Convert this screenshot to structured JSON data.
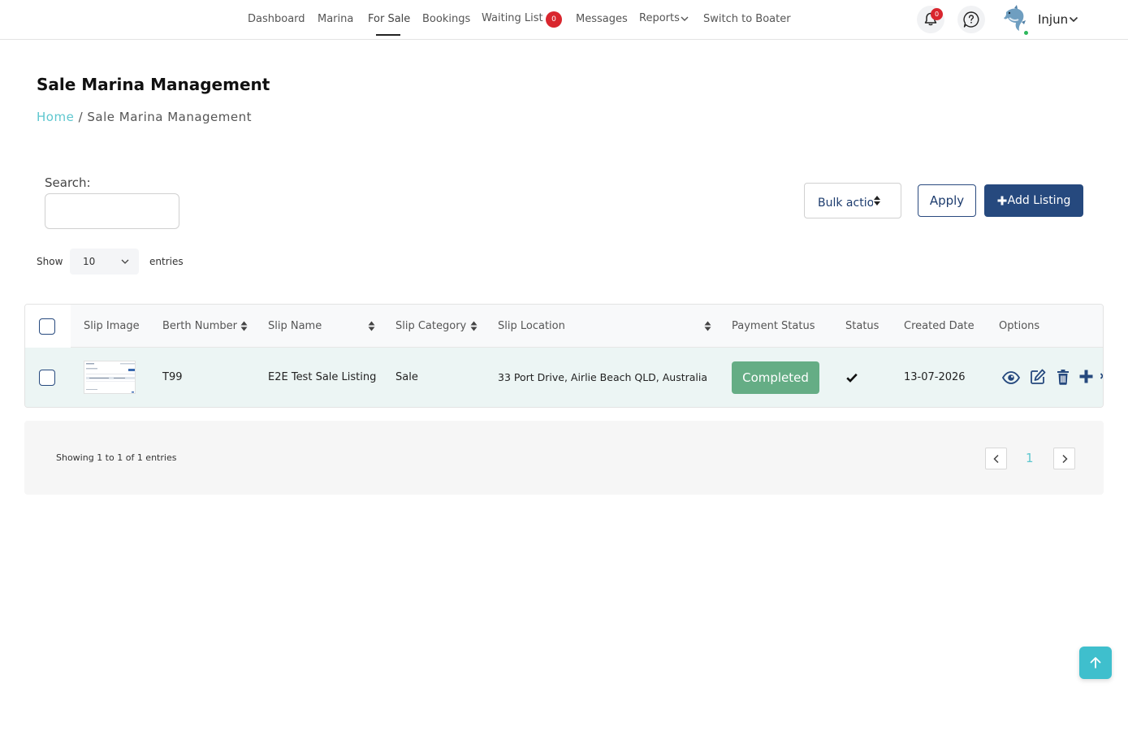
{
  "nav": {
    "items": [
      {
        "label": "Dashboard"
      },
      {
        "label": "Marina"
      },
      {
        "label": "For Sale"
      },
      {
        "label": "Bookings"
      },
      {
        "label": "Waiting List"
      },
      {
        "label": "Messages"
      },
      {
        "label": "Reports"
      },
      {
        "label": "Switch to Boater"
      }
    ],
    "active": "For Sale",
    "waiting_list_count": "0",
    "notifications_count": "0",
    "user_name": "Injun"
  },
  "page": {
    "title": "Sale Marina Management",
    "breadcrumb": {
      "home": "Home",
      "separator": " / ",
      "current": "Sale Marina Management"
    }
  },
  "controls": {
    "search_label": "Search:",
    "search_value": "",
    "bulk_action": "Bulk actions",
    "apply_label": "Apply",
    "add_label": "Add Listing",
    "show_label": "Show",
    "entries_value": "10",
    "entries_label": "entries"
  },
  "table": {
    "headers": [
      "Slip Image",
      "Berth Number",
      "Slip Name",
      "Slip Category",
      "Slip Location",
      "Payment Status",
      "Status",
      "Created Date",
      "Options"
    ],
    "rows": [
      {
        "berth_number": "T99",
        "slip_name": "E2E Test Sale Listing",
        "slip_category": "Sale",
        "slip_location": "33 Port Drive, Airlie Beach QLD, Australia",
        "payment_status": "Completed",
        "status": "active-check",
        "created_date": "13-07-2026"
      }
    ]
  },
  "footer": {
    "showing": "Showing 1 to 1 of 1 entries",
    "page": "1"
  },
  "colors": {
    "primary": "#26497e",
    "accent": "#5ec7cf",
    "success": "#65ad85",
    "badge": "#d9262e",
    "row_highlight": "#ecf5f4"
  }
}
